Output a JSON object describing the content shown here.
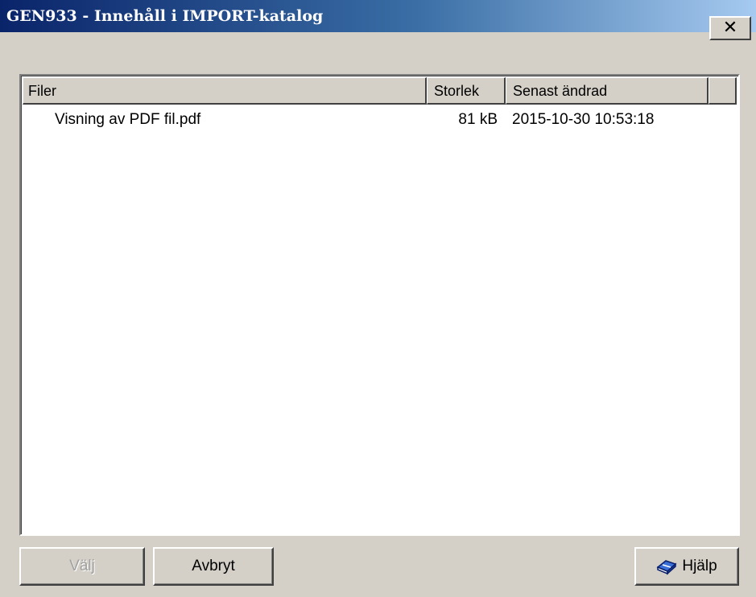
{
  "window": {
    "title": "GEN933 - Innehåll i IMPORT-katalog",
    "close_label": "✕"
  },
  "list": {
    "columns": [
      "Filer",
      "Storlek",
      "Senast ändrad"
    ],
    "rows": [
      {
        "name": "Visning av PDF fil.pdf",
        "size": "81 kB",
        "modified": "2015-10-30 10:53:18"
      }
    ]
  },
  "buttons": {
    "select_label": "Välj",
    "select_enabled": false,
    "cancel_label": "Avbryt",
    "help_label": "Hjälp",
    "help_icon": "help-book-icon"
  },
  "colors": {
    "titlebar_start": "#0a246a",
    "titlebar_end": "#a6caf0",
    "face": "#d4d0c8"
  }
}
